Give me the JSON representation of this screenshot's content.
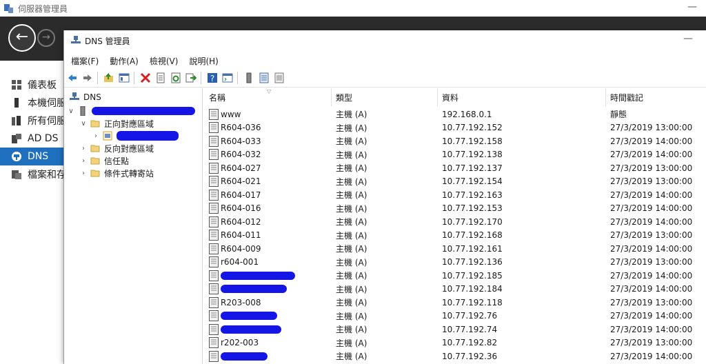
{
  "server_manager": {
    "title": "伺服器管理員",
    "sidebar": [
      {
        "label": "儀表板",
        "icon": "dashboard-icon"
      },
      {
        "label": "本機伺服",
        "icon": "local-server-icon"
      },
      {
        "label": "所有伺服",
        "icon": "all-servers-icon"
      },
      {
        "label": "AD DS",
        "icon": "ad-ds-icon"
      },
      {
        "label": "DNS",
        "icon": "dns-icon",
        "active": true
      },
      {
        "label": "檔案和存",
        "icon": "file-storage-icon"
      }
    ]
  },
  "dns_manager": {
    "title": "DNS 管理員",
    "menu": [
      "檔案(F)",
      "動作(A)",
      "檢視(V)",
      "說明(H)"
    ],
    "toolbar": [
      "back-icon",
      "forward-icon",
      "up-folder-icon",
      "show-hide-tree-icon",
      "delete-icon",
      "properties-icon",
      "refresh-icon",
      "export-icon",
      "help-icon",
      "console-icon",
      "server-icon",
      "list-icon",
      "records-icon"
    ],
    "tree": {
      "root": "DNS",
      "server": "",
      "items": [
        "正向對應區域",
        "",
        "反向對應區域",
        "信任點",
        "條件式轉寄站"
      ]
    },
    "columns": [
      "名稱",
      "類型",
      "資料",
      "時間戳記"
    ],
    "rows": [
      {
        "name": "www",
        "type": "主機 (A)",
        "data": "192.168.0.1",
        "timestamp": "靜態"
      },
      {
        "name": "R604-036",
        "type": "主機 (A)",
        "data": "10.77.192.152",
        "timestamp": "27/3/2019 13:00:00"
      },
      {
        "name": "R604-033",
        "type": "主機 (A)",
        "data": "10.77.192.158",
        "timestamp": "27/3/2019 14:00:00"
      },
      {
        "name": "R604-032",
        "type": "主機 (A)",
        "data": "10.77.192.138",
        "timestamp": "27/3/2019 14:00:00"
      },
      {
        "name": "R604-027",
        "type": "主機 (A)",
        "data": "10.77.192.137",
        "timestamp": "27/3/2019 13:00:00"
      },
      {
        "name": "R604-021",
        "type": "主機 (A)",
        "data": "10.77.192.154",
        "timestamp": "27/3/2019 13:00:00"
      },
      {
        "name": "R604-017",
        "type": "主機 (A)",
        "data": "10.77.192.163",
        "timestamp": "27/3/2019 14:00:00"
      },
      {
        "name": "R604-016",
        "type": "主機 (A)",
        "data": "10.77.192.153",
        "timestamp": "27/3/2019 14:00:00"
      },
      {
        "name": "R604-012",
        "type": "主機 (A)",
        "data": "10.77.192.170",
        "timestamp": "27/3/2019 14:00:00"
      },
      {
        "name": "R604-011",
        "type": "主機 (A)",
        "data": "10.77.192.168",
        "timestamp": "27/3/2019 13:00:00"
      },
      {
        "name": "R604-009",
        "type": "主機 (A)",
        "data": "10.77.192.161",
        "timestamp": "27/3/2019 14:00:00"
      },
      {
        "name": "r604-001",
        "type": "主機 (A)",
        "data": "10.77.192.136",
        "timestamp": "27/3/2019 13:00:00"
      },
      {
        "name": "",
        "type": "主機 (A)",
        "data": "10.77.192.185",
        "timestamp": "27/3/2019 14:00:00",
        "redacted": true
      },
      {
        "name": "",
        "type": "主機 (A)",
        "data": "10.77.192.184",
        "timestamp": "27/3/2019 14:00:00",
        "redacted": true
      },
      {
        "name": "R203-008",
        "type": "主機 (A)",
        "data": "10.77.192.118",
        "timestamp": "27/3/2019 13:00:00"
      },
      {
        "name": "",
        "type": "主機 (A)",
        "data": "10.77.192.76",
        "timestamp": "27/3/2019 14:00:00",
        "redacted": true
      },
      {
        "name": "",
        "type": "主機 (A)",
        "data": "10.77.192.74",
        "timestamp": "27/3/2019 14:00:00",
        "redacted": true
      },
      {
        "name": "r202-003",
        "type": "主機 (A)",
        "data": "10.77.192.82",
        "timestamp": "27/3/2019 13:00:00"
      },
      {
        "name": "",
        "type": "主機 (A)",
        "data": "10.77.192.36",
        "timestamp": "27/3/2019 14:00:00",
        "redacted": true
      }
    ]
  }
}
